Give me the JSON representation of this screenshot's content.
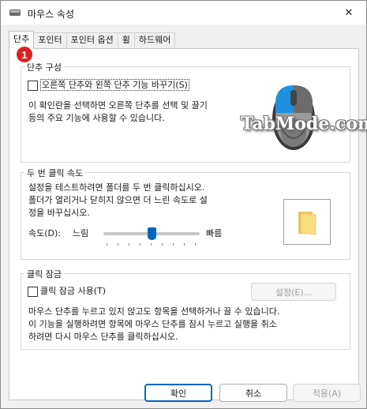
{
  "window": {
    "title": "마우스 속성",
    "close_symbol": "✕"
  },
  "tabs": [
    {
      "label": "단추",
      "active": true
    },
    {
      "label": "포인터",
      "active": false
    },
    {
      "label": "포인터 옵션",
      "active": false
    },
    {
      "label": "휠",
      "active": false
    },
    {
      "label": "하드웨어",
      "active": false
    }
  ],
  "callout": "1",
  "button_config": {
    "title": "단추 구성",
    "checkbox_label": "오른쪽 단추와 왼쪽 단추 기능 바꾸기(S)",
    "checked": false,
    "description_line1": "이 확인란을 선택하면 오른쪽 단추를 선택 및 끌기",
    "description_line2": "등의 주요 기능에 사용할 수 있습니다."
  },
  "watermark": "TabMode.com",
  "double_click": {
    "title": "두 번 클릭 속도",
    "line1": "설정을 테스트하려면 폴더를 두 번 클릭하십시오.",
    "line2": "폴더가 열리거나 닫히지 않으면 더 느린 속도로 설",
    "line3": "정을 바꾸십시오.",
    "speed_label": "속도(D):",
    "slow_label": "느림",
    "fast_label": "빠름",
    "speed_level": 0.5
  },
  "click_lock": {
    "title": "클릭 잠금",
    "checkbox_label": "클릭 잠금 사용(T)",
    "checked": false,
    "settings_button": "설정(E)...",
    "line1": "마우스 단추를 누르고 있지 않고도 항목을 선택하거나 끌 수 있습니다.",
    "line2": "이 기능을 실행하려면 항목에 마우스 단추를 잠시 누르고 실행을 취소",
    "line3": "하려면 다시 마우스 단추를 클릭하십시오."
  },
  "footer": {
    "ok": "확인",
    "cancel": "취소",
    "apply": "적용(A)"
  },
  "colors": {
    "accent": "#0067c0",
    "callout": "#e02020",
    "mouse_highlight": "#1e90e0"
  }
}
